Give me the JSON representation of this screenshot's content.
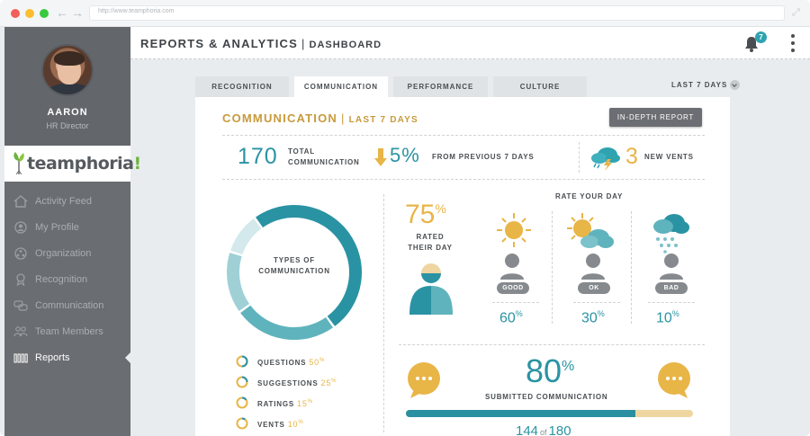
{
  "browser": {
    "url": "http://www.teamphoria.com"
  },
  "sidebar": {
    "user_name": "AARON",
    "user_role": "HR Director",
    "logo_text": "teamphoria",
    "logo_bang": "!",
    "items": [
      {
        "label": "Activity Feed",
        "icon": "home-icon"
      },
      {
        "label": "My Profile",
        "icon": "user-icon"
      },
      {
        "label": "Organization",
        "icon": "org-icon"
      },
      {
        "label": "Recognition",
        "icon": "award-icon"
      },
      {
        "label": "Communication",
        "icon": "chat-icon"
      },
      {
        "label": "Team Members",
        "icon": "team-icon"
      },
      {
        "label": "Reports",
        "icon": "bar-chart-icon",
        "active": true
      }
    ]
  },
  "header": {
    "title": "REPORTS & ANALYTICS",
    "subtitle": "DASHBOARD",
    "notification_count": "7"
  },
  "tabs": [
    {
      "label": "RECOGNITION"
    },
    {
      "label": "COMMUNICATION",
      "active": true
    },
    {
      "label": "PERFORMANCE"
    },
    {
      "label": "CULTURE"
    }
  ],
  "period_selector": "LAST 7 DAYS",
  "panel": {
    "title": "COMMUNICATION",
    "period": "LAST 7 DAYS",
    "report_button": "IN-DEPTH REPORT",
    "total_value": "170",
    "total_label_1": "TOTAL",
    "total_label_2": "COMMUNICATION",
    "change_value": "5%",
    "change_label": "FROM PREVIOUS 7 DAYS",
    "vents_value": "3",
    "vents_label": "NEW VENTS",
    "donut_label_1": "TYPES OF",
    "donut_label_2": "COMMUNICATION",
    "types": [
      {
        "label": "QUESTIONS",
        "value": "50",
        "pct": 50
      },
      {
        "label": "SUGGESTIONS",
        "value": "25",
        "pct": 25
      },
      {
        "label": "RATINGS",
        "value": "15",
        "pct": 15
      },
      {
        "label": "VENTS",
        "value": "10",
        "pct": 10
      }
    ],
    "rated_value": "75",
    "rated_label_1": "RATED",
    "rated_label_2": "THEIR DAY",
    "rate_title": "RATE YOUR DAY",
    "moods": [
      {
        "label": "GOOD",
        "value": "60",
        "icon": "sun-icon"
      },
      {
        "label": "OK",
        "value": "30",
        "icon": "partly-cloudy-icon"
      },
      {
        "label": "BAD",
        "value": "10",
        "icon": "rain-cloud-icon"
      }
    ],
    "submitted_value": "80",
    "submitted_label": "SUBMITTED COMMUNICATION",
    "submitted_count": "144",
    "submitted_of": "of",
    "submitted_total": "180",
    "submitted_fraction": 0.8
  },
  "colors": {
    "teal": "#2a93a3",
    "gold": "#e8b547",
    "sidebar": "#6a6e72"
  }
}
